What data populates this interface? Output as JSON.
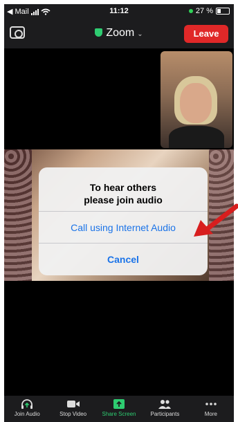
{
  "status_bar": {
    "back_app": "◀ Mail",
    "time": "11:12",
    "battery": "27 %"
  },
  "header": {
    "title": "Zoom",
    "leave_label": "Leave"
  },
  "dialog": {
    "message_line1": "To hear others",
    "message_line2": "please join audio",
    "internet_audio_label": "Call using Internet Audio",
    "cancel_label": "Cancel"
  },
  "toolbar": {
    "items": [
      {
        "label": "Join Audio",
        "icon": "headphone-icon"
      },
      {
        "label": "Stop Video",
        "icon": "video-camera-icon"
      },
      {
        "label": "Share Screen",
        "icon": "share-screen-icon"
      },
      {
        "label": "Participants",
        "icon": "participants-icon"
      },
      {
        "label": "More",
        "icon": "more-icon"
      }
    ]
  },
  "colors": {
    "leave": "#e02828",
    "accent_blue": "#1a73e8",
    "share_green": "#2ecc71",
    "annotation_arrow": "#d81e1e"
  }
}
